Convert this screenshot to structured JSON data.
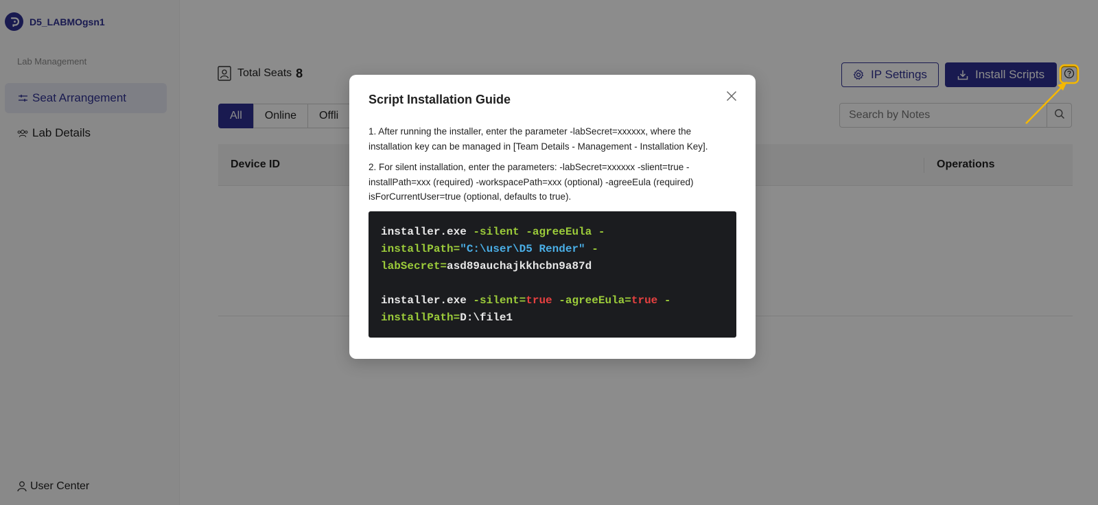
{
  "sidebar": {
    "brand_name": "D5_LABMOgsn1",
    "section_title": "Lab Management",
    "items": [
      {
        "label": "Seat Arrangement",
        "active": true
      },
      {
        "label": "Lab Details",
        "active": false
      }
    ],
    "user_center_label": "User Center"
  },
  "header": {
    "total_seats_label": "Total Seats",
    "total_seats_count": "8",
    "ip_settings_label": "IP Settings",
    "install_scripts_label": "Install Scripts"
  },
  "filters": {
    "tabs": [
      "All",
      "Online",
      "Offli"
    ],
    "active_tab": "All"
  },
  "search": {
    "placeholder": "Search by Notes"
  },
  "table": {
    "columns": [
      "Device ID",
      "Operations"
    ]
  },
  "modal": {
    "title": "Script Installation Guide",
    "para1_line1": "1. After running the installer, enter the parameter -labSecret=xxxxxx, where the",
    "para1_line2": "installation key can be managed in [Team Details - Management - Installation Key].",
    "para2_line1": "2. For silent installation, enter the parameters: -labSecret=xxxxxx -slient=true -",
    "para2_line2": "installPath=xxx (required) -workspacePath=xxx (optional) -agreeEula (required)",
    "para2_line3": "isForCurrentUser=true (optional, defaults to true).",
    "code": {
      "l1_cmd": "installer.exe",
      "l1_flags": " -silent -agreeEula -",
      "l2_flag": "installPath=",
      "l2_str": "\"C:\\user\\D5 Render\"",
      "l2_tail": " -",
      "l3_flag": "labSecret=",
      "l3_val": "asd89auchajkkhcbn9a87d",
      "l4_cmd": "installer.exe",
      "l4_f1": " -silent=",
      "l4_v1": "true",
      "l4_f2": " -agreeEula=",
      "l4_v2": "true",
      "l4_tail": " -",
      "l5_flag": "installPath=",
      "l5_val": "D:\\file1"
    }
  },
  "colors": {
    "brand": "#2f3192",
    "highlight": "#f5b800",
    "code_bg": "#1b1c1f",
    "code_flag": "#9ccc3a",
    "code_string": "#4aaee6",
    "code_keyword": "#e54040"
  },
  "icons": [
    "brand-logo-icon",
    "sliders-icon",
    "users-icon",
    "user-icon",
    "seat-icon",
    "gear-icon",
    "download-icon",
    "help-icon",
    "search-icon",
    "close-icon"
  ]
}
